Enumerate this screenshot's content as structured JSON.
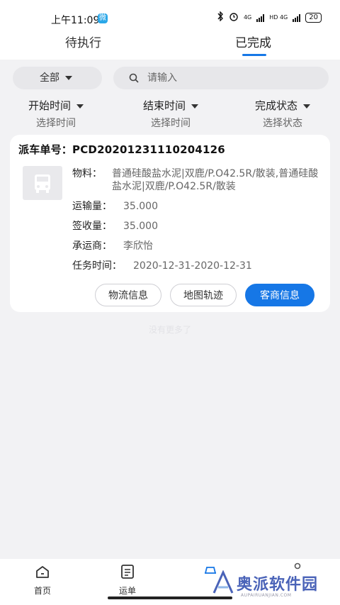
{
  "status_bar": {
    "time": "上午11:09",
    "badge": "微",
    "network_1": "4G",
    "network_2": "HD 4G",
    "battery": "20"
  },
  "tabs": {
    "pending": "待执行",
    "completed": "已完成"
  },
  "filters": {
    "all_label": "全部",
    "search_placeholder": "请输入",
    "start_time": {
      "title": "开始时间",
      "placeholder": "选择时间"
    },
    "end_time": {
      "title": "结束时间",
      "placeholder": "选择时间"
    },
    "status": {
      "title": "完成状态",
      "placeholder": "选择状态"
    }
  },
  "order": {
    "dispatch_label": "派车单号：",
    "dispatch_no": "PCD20201231110204126",
    "material_label": "物料：",
    "material_value": "普通硅酸盐水泥|双鹿/P.O42.5R/散装,普通硅酸盐水泥|双鹿/P.O42.5R/散装",
    "transport_qty_label": "运输量：",
    "transport_qty": "35.000",
    "received_qty_label": "签收量：",
    "received_qty": "35.000",
    "carrier_label": "承运商：",
    "carrier": "李欣怡",
    "task_time_label": "任务时间：",
    "task_time": "2020-12-31-2020-12-31",
    "buttons": {
      "logistics": "物流信息",
      "map_track": "地图轨迹",
      "merchant": "客商信息"
    }
  },
  "footer_hint": "没有更多了",
  "bottom_nav": {
    "home": "首页",
    "waybill": "运单"
  },
  "watermark": {
    "text": "奥派软件园",
    "url": "AUPAIRUANJIAN.COM"
  },
  "colors": {
    "accent": "#1677e6",
    "background": "#f2f2f4"
  }
}
